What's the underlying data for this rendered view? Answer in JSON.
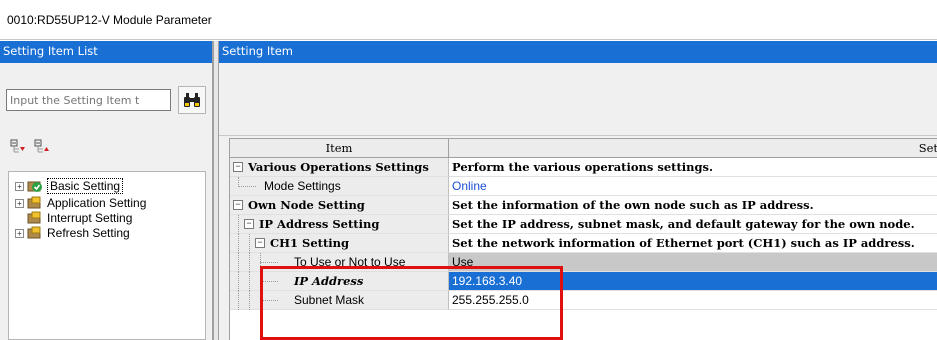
{
  "window": {
    "title": "0010:RD55UP12-V Module Parameter"
  },
  "left_pane": {
    "header": "Setting Item List",
    "search_placeholder": "Input the Setting Item t",
    "search_button_icon": "binoculars-icon",
    "tree_tools": [
      "expand-all-icon",
      "collapse-all-icon"
    ],
    "tree": [
      {
        "label": "Basic Setting",
        "icon": "check-folder-icon",
        "selected": true
      },
      {
        "label": "Application Setting",
        "icon": "folder-icon"
      },
      {
        "label": "Interrupt Setting",
        "icon": "folder-icon"
      },
      {
        "label": "Refresh Setting",
        "icon": "folder-icon"
      }
    ]
  },
  "right_pane": {
    "header": "Setting Item",
    "grid": {
      "col_item": "Item",
      "col_setting": "Set",
      "rows": [
        {
          "item": "Various Operations Settings",
          "value": "Perform the various operations settings."
        },
        {
          "item": "Mode Settings",
          "value": "Online"
        },
        {
          "item": "Own Node Setting",
          "value": "Set the information of the own node such as IP address."
        },
        {
          "item": "IP Address Setting",
          "value": "Set the IP address, subnet mask, and default gateway for the own node."
        },
        {
          "item": "CH1 Setting",
          "value": "Set the network information of Ethernet port (CH1) such as IP address."
        },
        {
          "item": "To Use or Not to Use",
          "value": "Use"
        },
        {
          "item": "IP Address",
          "value": "192.168.3.40"
        },
        {
          "item": "Subnet Mask",
          "value": "255.255.255.0"
        }
      ]
    }
  },
  "colors": {
    "header_blue": "#1a6fd4",
    "highlight_red": "#e01010",
    "link_blue": "#1a4fd6"
  }
}
